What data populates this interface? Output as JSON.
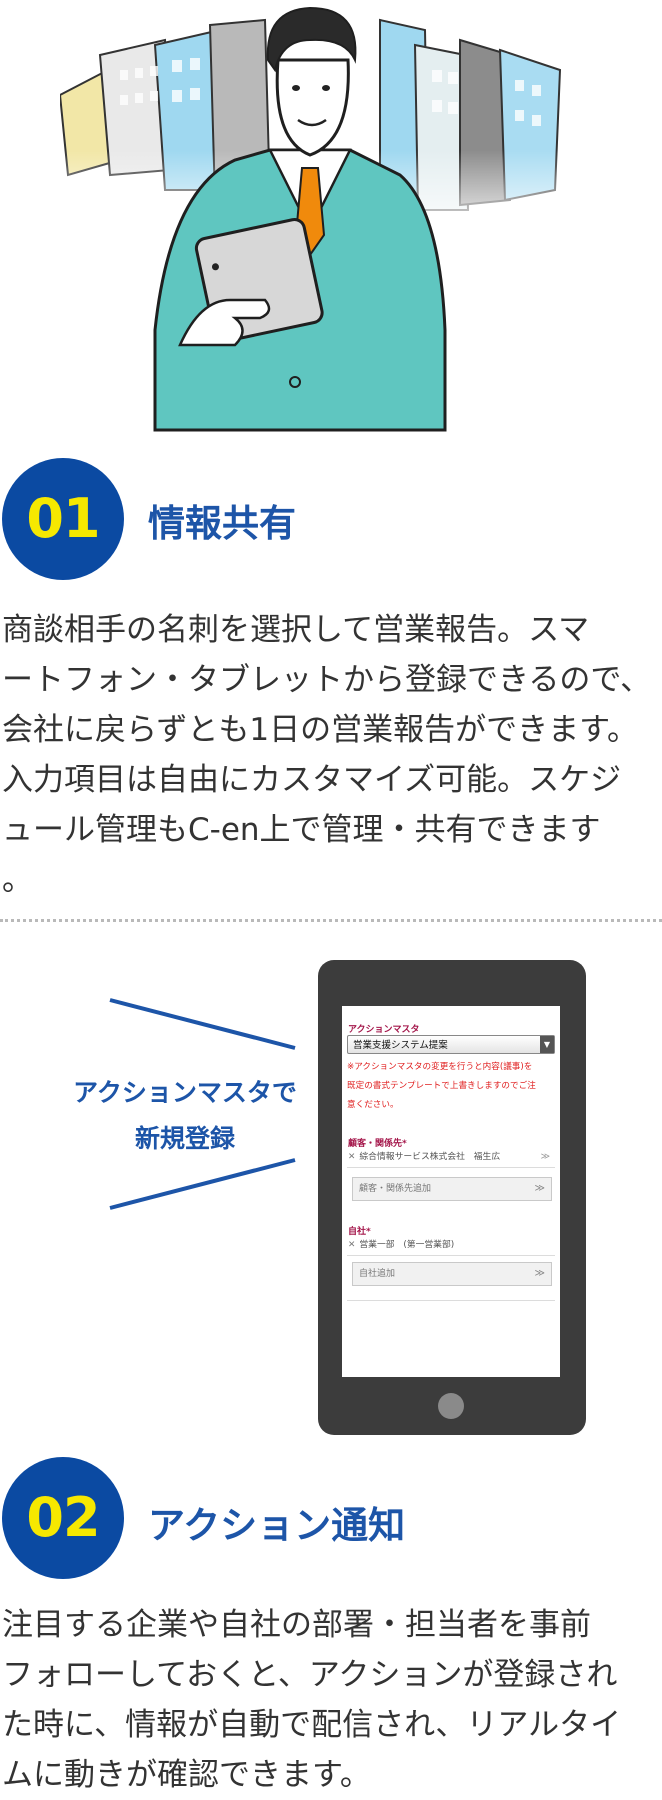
{
  "hero": {
    "image": "businessman-with-tablet-illustration"
  },
  "sections": [
    {
      "number": "01",
      "title": "情報共有",
      "text_lines": [
        "商談相手の名刺を選択して営業報告。スマ",
        "ートフォン・タブレットから登録できるので、",
        "会社に戻らずとも1日の営業報告ができます。",
        "入力項目は自由にカスタマイズ可能。スケジ",
        "ュール管理もC-en上で管理・共有できます",
        "。"
      ]
    },
    {
      "number": "02",
      "title": "アクション通知",
      "text_lines": [
        "注目する企業や自社の部署・担当者を事前",
        "フォローしておくと、アクションが登録され",
        "た時に、情報が自動で配信され、リアルタイ",
        "ムに動きが確認できます。"
      ]
    }
  ],
  "callout": {
    "line1": "アクションマスタで",
    "line2": "新規登録"
  },
  "phone_screen": {
    "action_master_label": "アクションマスタ",
    "action_master_value": "営業支援システム提案",
    "warning_lines": [
      "※アクションマスタの変更を行うと内容(議事)を",
      "既定の書式テンプレートで上書きしますのでご注",
      "意ください。"
    ],
    "customer_label": "顧客・関係先*",
    "customer_tag": "綜合情報サービス株式会社　福生広",
    "customer_add": "顧客・関係先追加",
    "own_company_label": "自社*",
    "own_company_tag": "営業一部　(第一営業部)",
    "own_company_add": "自社追加"
  },
  "colors": {
    "badge": "#0b4aa2",
    "badge_text": "#f6e800",
    "title": "#1d55a8",
    "warning": "#e02020"
  }
}
